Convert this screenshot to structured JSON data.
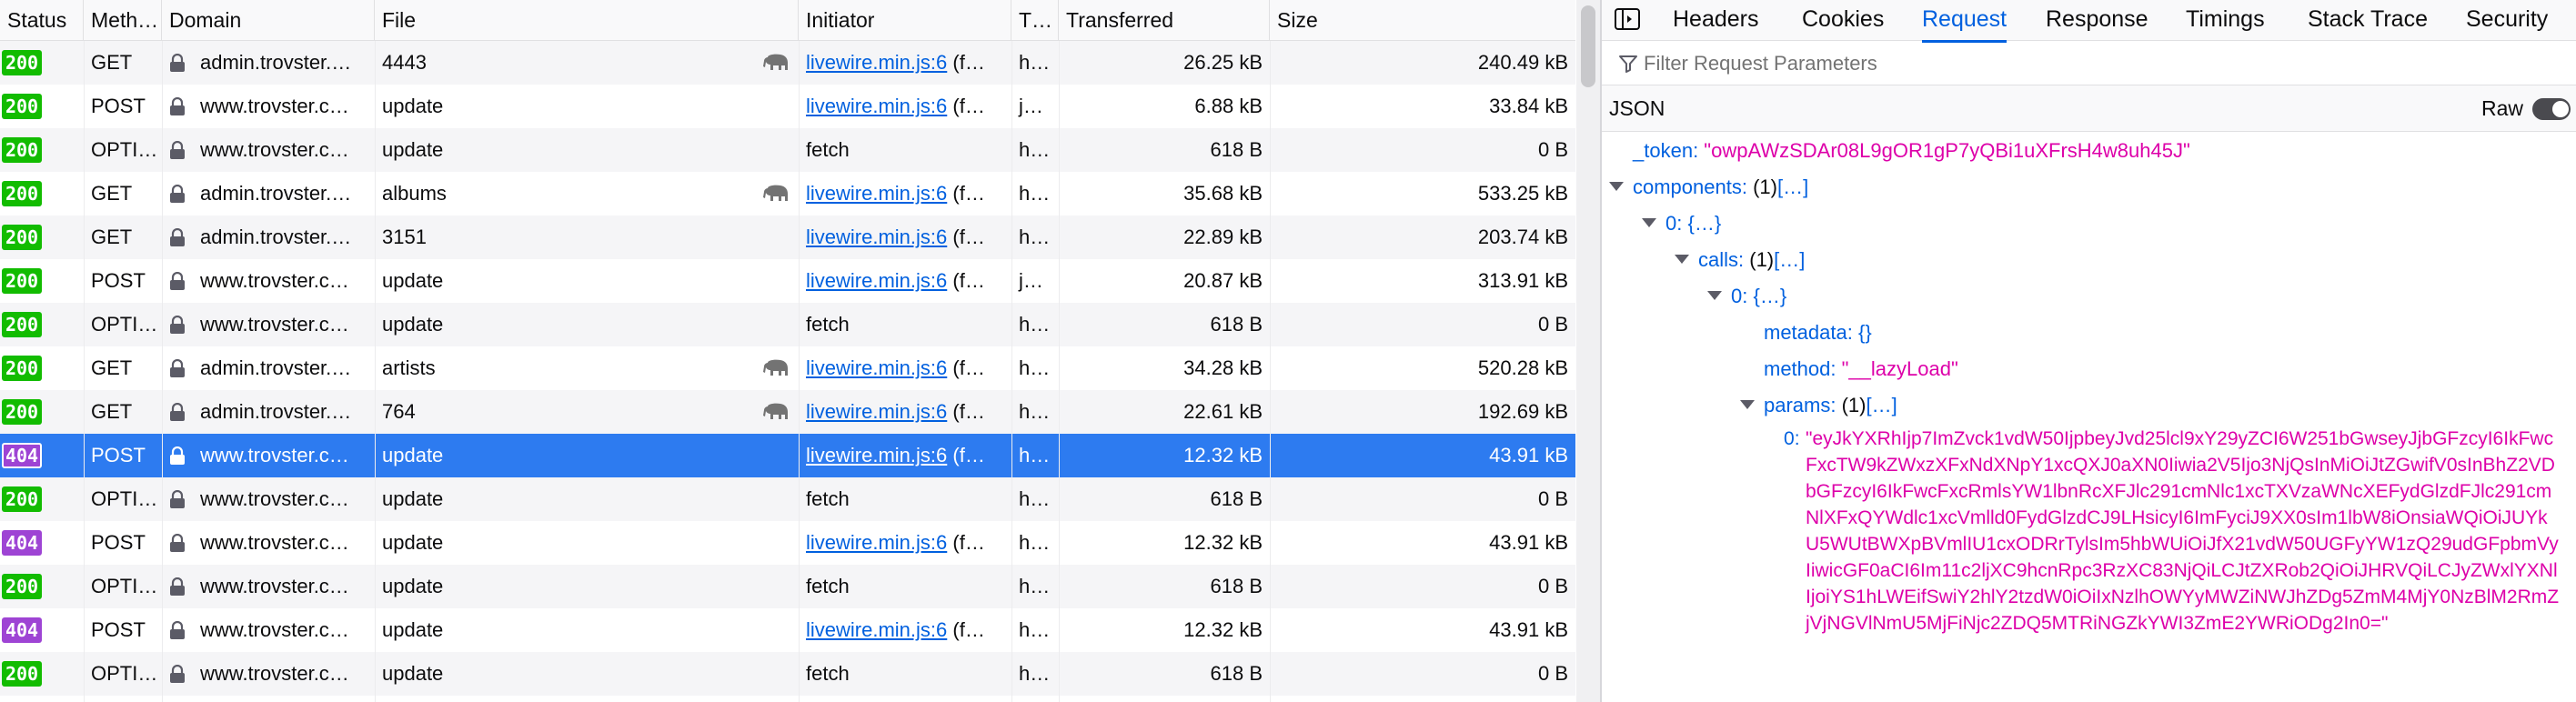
{
  "columns": [
    "Status",
    "Meth…",
    "Domain",
    "File",
    "Initiator",
    "T…",
    "Transferred",
    "Size"
  ],
  "rows": [
    {
      "status": "200",
      "method": "GET",
      "domain": "admin.trovster.…",
      "file": "4443",
      "initiator_link": "livewire.min.js:6",
      "initiator_rest": " (f…",
      "type": "h…",
      "transferred": "26.25 kB",
      "size": "240.49 kB",
      "cached": true
    },
    {
      "status": "200",
      "method": "POST",
      "domain": "www.trovster.c…",
      "file": "update",
      "initiator_link": "livewire.min.js:6",
      "initiator_rest": " (f…",
      "type": "j…",
      "transferred": "6.88 kB",
      "size": "33.84 kB",
      "cached": false
    },
    {
      "status": "200",
      "method": "OPTI…",
      "domain": "www.trovster.c…",
      "file": "update",
      "initiator_link": "",
      "initiator_rest": "fetch",
      "type": "h…",
      "transferred": "618 B",
      "size": "0 B",
      "cached": false
    },
    {
      "status": "200",
      "method": "GET",
      "domain": "admin.trovster.…",
      "file": "albums",
      "initiator_link": "livewire.min.js:6",
      "initiator_rest": " (f…",
      "type": "h…",
      "transferred": "35.68 kB",
      "size": "533.25 kB",
      "cached": true
    },
    {
      "status": "200",
      "method": "GET",
      "domain": "admin.trovster.…",
      "file": "3151",
      "initiator_link": "livewire.min.js:6",
      "initiator_rest": " (f…",
      "type": "h…",
      "transferred": "22.89 kB",
      "size": "203.74 kB",
      "cached": false
    },
    {
      "status": "200",
      "method": "POST",
      "domain": "www.trovster.c…",
      "file": "update",
      "initiator_link": "livewire.min.js:6",
      "initiator_rest": " (f…",
      "type": "j…",
      "transferred": "20.87 kB",
      "size": "313.91 kB",
      "cached": false
    },
    {
      "status": "200",
      "method": "OPTI…",
      "domain": "www.trovster.c…",
      "file": "update",
      "initiator_link": "",
      "initiator_rest": "fetch",
      "type": "h…",
      "transferred": "618 B",
      "size": "0 B",
      "cached": false
    },
    {
      "status": "200",
      "method": "GET",
      "domain": "admin.trovster.…",
      "file": "artists",
      "initiator_link": "livewire.min.js:6",
      "initiator_rest": " (f…",
      "type": "h…",
      "transferred": "34.28 kB",
      "size": "520.28 kB",
      "cached": true
    },
    {
      "status": "200",
      "method": "GET",
      "domain": "admin.trovster.…",
      "file": "764",
      "initiator_link": "livewire.min.js:6",
      "initiator_rest": " (f…",
      "type": "h…",
      "transferred": "22.61 kB",
      "size": "192.69 kB",
      "cached": true
    },
    {
      "status": "404",
      "method": "POST",
      "domain": "www.trovster.c…",
      "file": "update",
      "initiator_link": "livewire.min.js:6",
      "initiator_rest": " (f…",
      "type": "h…",
      "transferred": "12.32 kB",
      "size": "43.91 kB",
      "cached": false,
      "selected": true
    },
    {
      "status": "200",
      "method": "OPTI…",
      "domain": "www.trovster.c…",
      "file": "update",
      "initiator_link": "",
      "initiator_rest": "fetch",
      "type": "h…",
      "transferred": "618 B",
      "size": "0 B",
      "cached": false
    },
    {
      "status": "404",
      "method": "POST",
      "domain": "www.trovster.c…",
      "file": "update",
      "initiator_link": "livewire.min.js:6",
      "initiator_rest": " (f…",
      "type": "h…",
      "transferred": "12.32 kB",
      "size": "43.91 kB",
      "cached": false
    },
    {
      "status": "200",
      "method": "OPTI…",
      "domain": "www.trovster.c…",
      "file": "update",
      "initiator_link": "",
      "initiator_rest": "fetch",
      "type": "h…",
      "transferred": "618 B",
      "size": "0 B",
      "cached": false
    },
    {
      "status": "404",
      "method": "POST",
      "domain": "www.trovster.c…",
      "file": "update",
      "initiator_link": "livewire.min.js:6",
      "initiator_rest": " (f…",
      "type": "h…",
      "transferred": "12.32 kB",
      "size": "43.91 kB",
      "cached": false
    },
    {
      "status": "200",
      "method": "OPTI…",
      "domain": "www.trovster.c…",
      "file": "update",
      "initiator_link": "",
      "initiator_rest": "fetch",
      "type": "h…",
      "transferred": "618 B",
      "size": "0 B",
      "cached": false
    }
  ],
  "tabs": [
    "Headers",
    "Cookies",
    "Request",
    "Response",
    "Timings",
    "Stack Trace",
    "Security"
  ],
  "active_tab": "Request",
  "filter": {
    "placeholder": "Filter Request Parameters",
    "value": ""
  },
  "json_label": "JSON",
  "raw_label": "Raw",
  "tree": [
    {
      "key": "_token",
      "value": "\"owpAWzSDAr08L9gOR1gP7yQBi1uXFrsH4w8uh45J\"",
      "type": "string",
      "level": 0,
      "twisty": false
    },
    {
      "key": "components",
      "count": "(1)",
      "summary": "[…]",
      "level": 0,
      "twisty": true
    },
    {
      "key": "0",
      "summary": "{…}",
      "level": 1,
      "twisty": true
    },
    {
      "key": "calls",
      "count": "(1)",
      "summary": "[…]",
      "level": 2,
      "twisty": true
    },
    {
      "key": "0",
      "summary": "{…}",
      "level": 3,
      "twisty": true
    },
    {
      "key": "metadata",
      "summary": "{}",
      "level": 4,
      "twisty": false
    },
    {
      "key": "method",
      "value": "\"__lazyLoad\"",
      "type": "string",
      "level": 4,
      "twisty": false
    },
    {
      "key": "params",
      "count": "(1)",
      "summary": "[…]",
      "level": 4,
      "twisty": true
    }
  ],
  "long_param": {
    "key": "0",
    "value": "\"eyJkYXRhIjp7ImZvck1vdW50IjpbeyJvd25lcl9xY29yZCI6W251bGwseyJjbGFzcyI6IkFwcFxcTW9kZWxzXFxNdXNpY1xcQXJ0aXN0Iiwia2V5Ijo3NjQsInMiOiJtZGwifV0sInBhZ2VDbGFzcyI6IkFwcFxcRmlsYW1lbnRcXFJlc291cmNlc1xcTXVzaWNcXEFydGlzdFJlc291cmNlXFxQYWdlc1xcVmlld0FydGlzdCJ9LHsicyI6ImFyciJ9XX0sIm1lbW8iOnsiaWQiOiJUYkU5WUtBWXpBVmlIU1cxODRrTylsIm5hbWUiOiJfX21vdW50UGFyYW1zQ29udGFpbmVyIiwicGF0aCI6Im11c2ljXC9hcnRpc3RzXC83NjQiLCJtZXRob2QiOiJHRVQiLCJyZWxlYXNlIjoiYS1hLWEifSwiY2hlY2tzdW0iOiIxNzlhOWYyMWZiNWJhZDg5ZmM4MjY0NzBlM2RmZjVjNGVlNmU5MjFiNjc2ZDQ5MTRiNGZkYWI3ZmE2YWRiODg2In0=\""
  }
}
